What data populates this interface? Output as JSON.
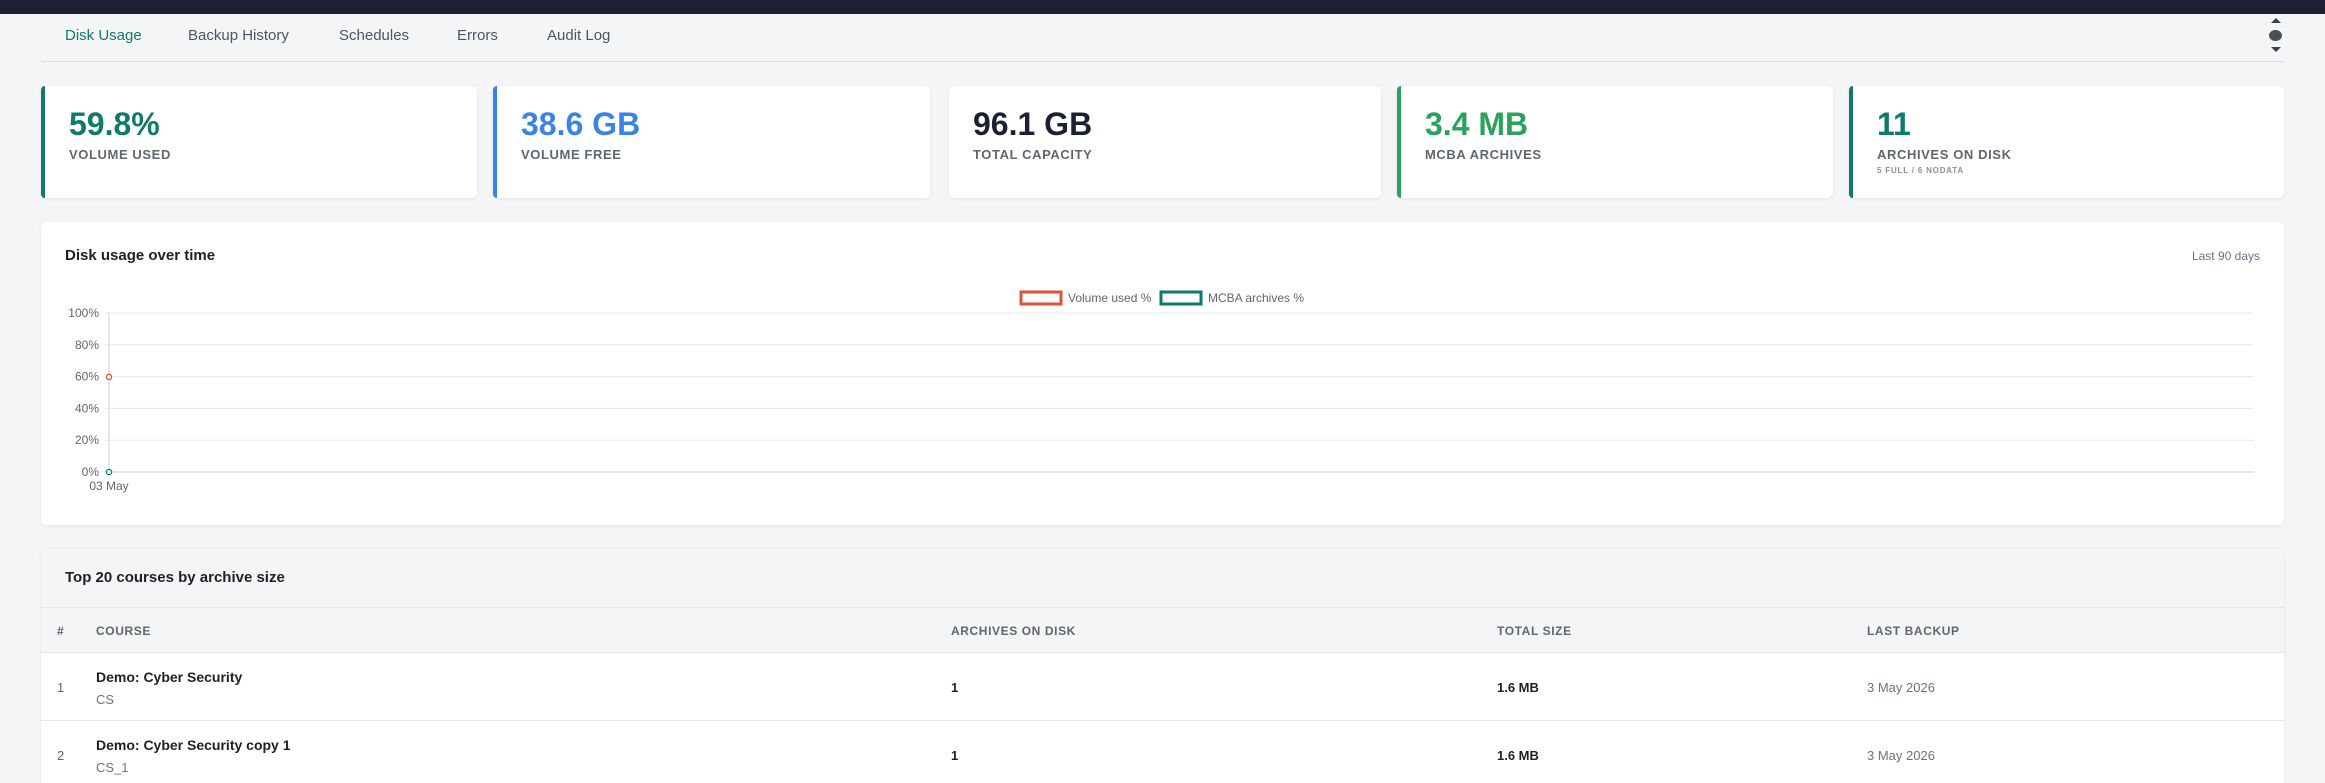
{
  "nav": {
    "tabs": [
      {
        "label": "Disk Usage",
        "active": true
      },
      {
        "label": "Backup History",
        "active": false
      },
      {
        "label": "Schedules",
        "active": false
      },
      {
        "label": "Errors",
        "active": false
      },
      {
        "label": "Audit Log",
        "active": false
      }
    ]
  },
  "stats": [
    {
      "value": "59.8%",
      "label": "VOLUME USED",
      "color": "#0f7a6c",
      "accent": "#0f7a6c"
    },
    {
      "value": "38.6 GB",
      "label": "VOLUME FREE",
      "color": "#3b82e6",
      "accent": "#3b82e6"
    },
    {
      "value": "96.1 GB",
      "label": "TOTAL CAPACITY",
      "color": "#1c2033",
      "accent": ""
    },
    {
      "value": "3.4 MB",
      "label": "MCBA ARCHIVES",
      "color": "#2aa25c",
      "accent": "#2aa25c"
    },
    {
      "value": "11",
      "label": "ARCHIVES ON DISK",
      "sub": "5 FULL  /  6 NODATA",
      "color": "#0f7a6c",
      "accent": "#0f7a6c"
    }
  ],
  "chart_card": {
    "title": "Disk usage over time",
    "range_label": "Last 90 days"
  },
  "chart_data": {
    "type": "line",
    "x": [
      "03 May"
    ],
    "series": [
      {
        "name": "Volume used %",
        "values": [
          59.8
        ],
        "color": "#e0503a"
      },
      {
        "name": "MCBA archives %",
        "values": [
          0
        ],
        "color": "#0f7a6c"
      }
    ],
    "y_ticks": [
      "0%",
      "20%",
      "40%",
      "60%",
      "80%",
      "100%"
    ],
    "ylim": [
      0,
      100
    ],
    "grid": true,
    "legend": "top-center"
  },
  "table": {
    "title": "Top 20 courses by archive size",
    "headers": [
      "#",
      "COURSE",
      "ARCHIVES ON DISK",
      "TOTAL SIZE",
      "LAST BACKUP"
    ],
    "rows": [
      {
        "num": "1",
        "name": "Demo: Cyber Security",
        "short": "CS",
        "archives": "1",
        "size": "1.6 MB",
        "last": "3 May 2026"
      },
      {
        "num": "2",
        "name": "Demo: Cyber Security copy 1",
        "short": "CS_1",
        "archives": "1",
        "size": "1.6 MB",
        "last": "3 May 2026"
      }
    ]
  }
}
